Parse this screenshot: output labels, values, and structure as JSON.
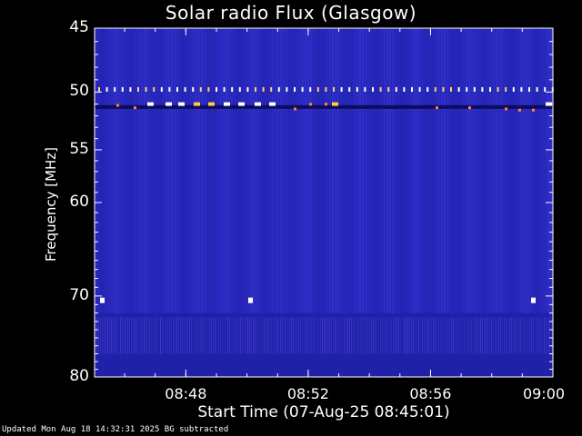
{
  "chart_data": {
    "type": "heatmap",
    "title": "Solar radio Flux (Glasgow)",
    "xlabel": "Start Time (07-Aug-25 08:45:01)",
    "ylabel": "Frequency [MHz]",
    "x_ticks": [
      "08:48",
      "08:52",
      "08:56",
      "09:00"
    ],
    "y_ticks": [
      "45",
      "50",
      "55",
      "60",
      "70",
      "80"
    ],
    "x_range": [
      "08:45:01",
      "09:00:00"
    ],
    "y_range": [
      45,
      80
    ],
    "y_scale": "log",
    "colors": {
      "background": "#000000",
      "low": "#1a1a8c",
      "mid": "#3030d0",
      "high": "#ffffff",
      "hot": "#ff9900"
    }
  },
  "footer": "Updated Mon Aug 18 14:32:31 2025   BG subtracted"
}
